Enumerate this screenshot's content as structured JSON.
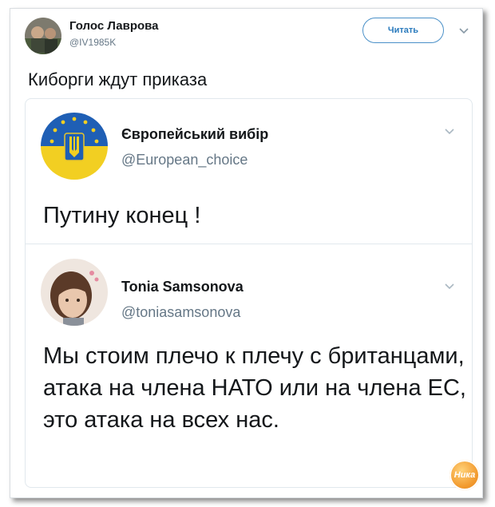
{
  "tweet": {
    "author_name": "Голос Лаврова",
    "author_handle": "@IV1985K",
    "follow_label": "Читать",
    "text": "Киборги ждут приказа"
  },
  "quoted_tweets": [
    {
      "author_name": "Європейський вибір",
      "author_handle": "@European_choice",
      "text": "Путину конец !"
    },
    {
      "author_name": "Tonia Samsonova",
      "author_handle": "@toniasamsonova",
      "text": "Мы стоим плечо к плечу с британцами, атака на члена НАТО или на члена ЕС, это атака на всех нас."
    }
  ],
  "watermark": {
    "text": "Ника"
  },
  "colors": {
    "text": "#14171a",
    "muted": "#657786",
    "accent": "#2b7bbd",
    "flag_blue": "#1f5fb5",
    "flag_yellow": "#f2cf22"
  },
  "icons": {
    "menu": "chevron-down-icon",
    "avatar_main": "avatar-photo",
    "avatar_quoted_1": "ukraine-trident-flag",
    "avatar_quoted_2": "avatar-photo"
  }
}
